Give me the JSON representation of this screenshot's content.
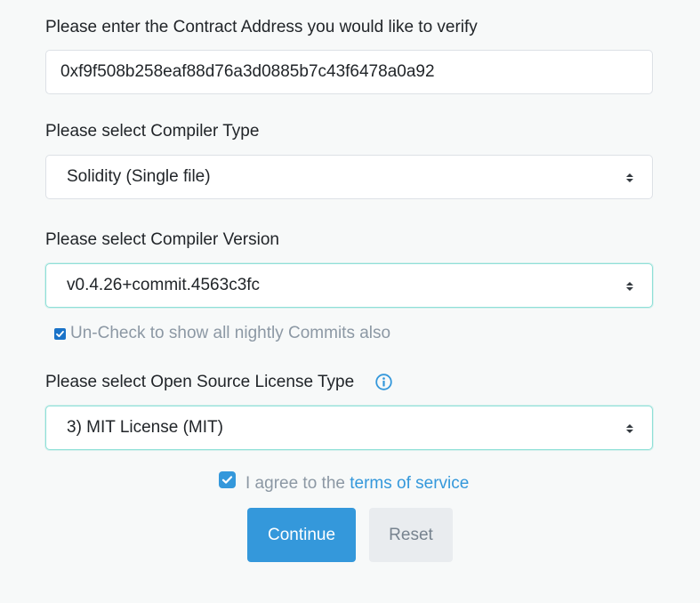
{
  "contract": {
    "label": "Please enter the Contract Address you would like to verify",
    "value": "0xf9f508b258eaf88d76a3d0885b7c43f6478a0a92"
  },
  "compiler_type": {
    "label": "Please select Compiler Type",
    "selected": "Solidity (Single file)"
  },
  "compiler_version": {
    "label": "Please select Compiler Version",
    "selected": "v0.4.26+commit.4563c3fc",
    "nightly_checked": true,
    "nightly_label": "Un-Check to show all nightly Commits also"
  },
  "license": {
    "label": "Please select Open Source License Type",
    "selected": "3) MIT License (MIT)",
    "info_icon": "info-circle-icon"
  },
  "agreement": {
    "checked": true,
    "prefix": "I agree to the",
    "link": "terms of service"
  },
  "buttons": {
    "continue": "Continue",
    "reset": "Reset"
  },
  "colors": {
    "accent": "#3498db",
    "focus_border": "#8fe0d8",
    "muted_text": "#8c98a4"
  }
}
